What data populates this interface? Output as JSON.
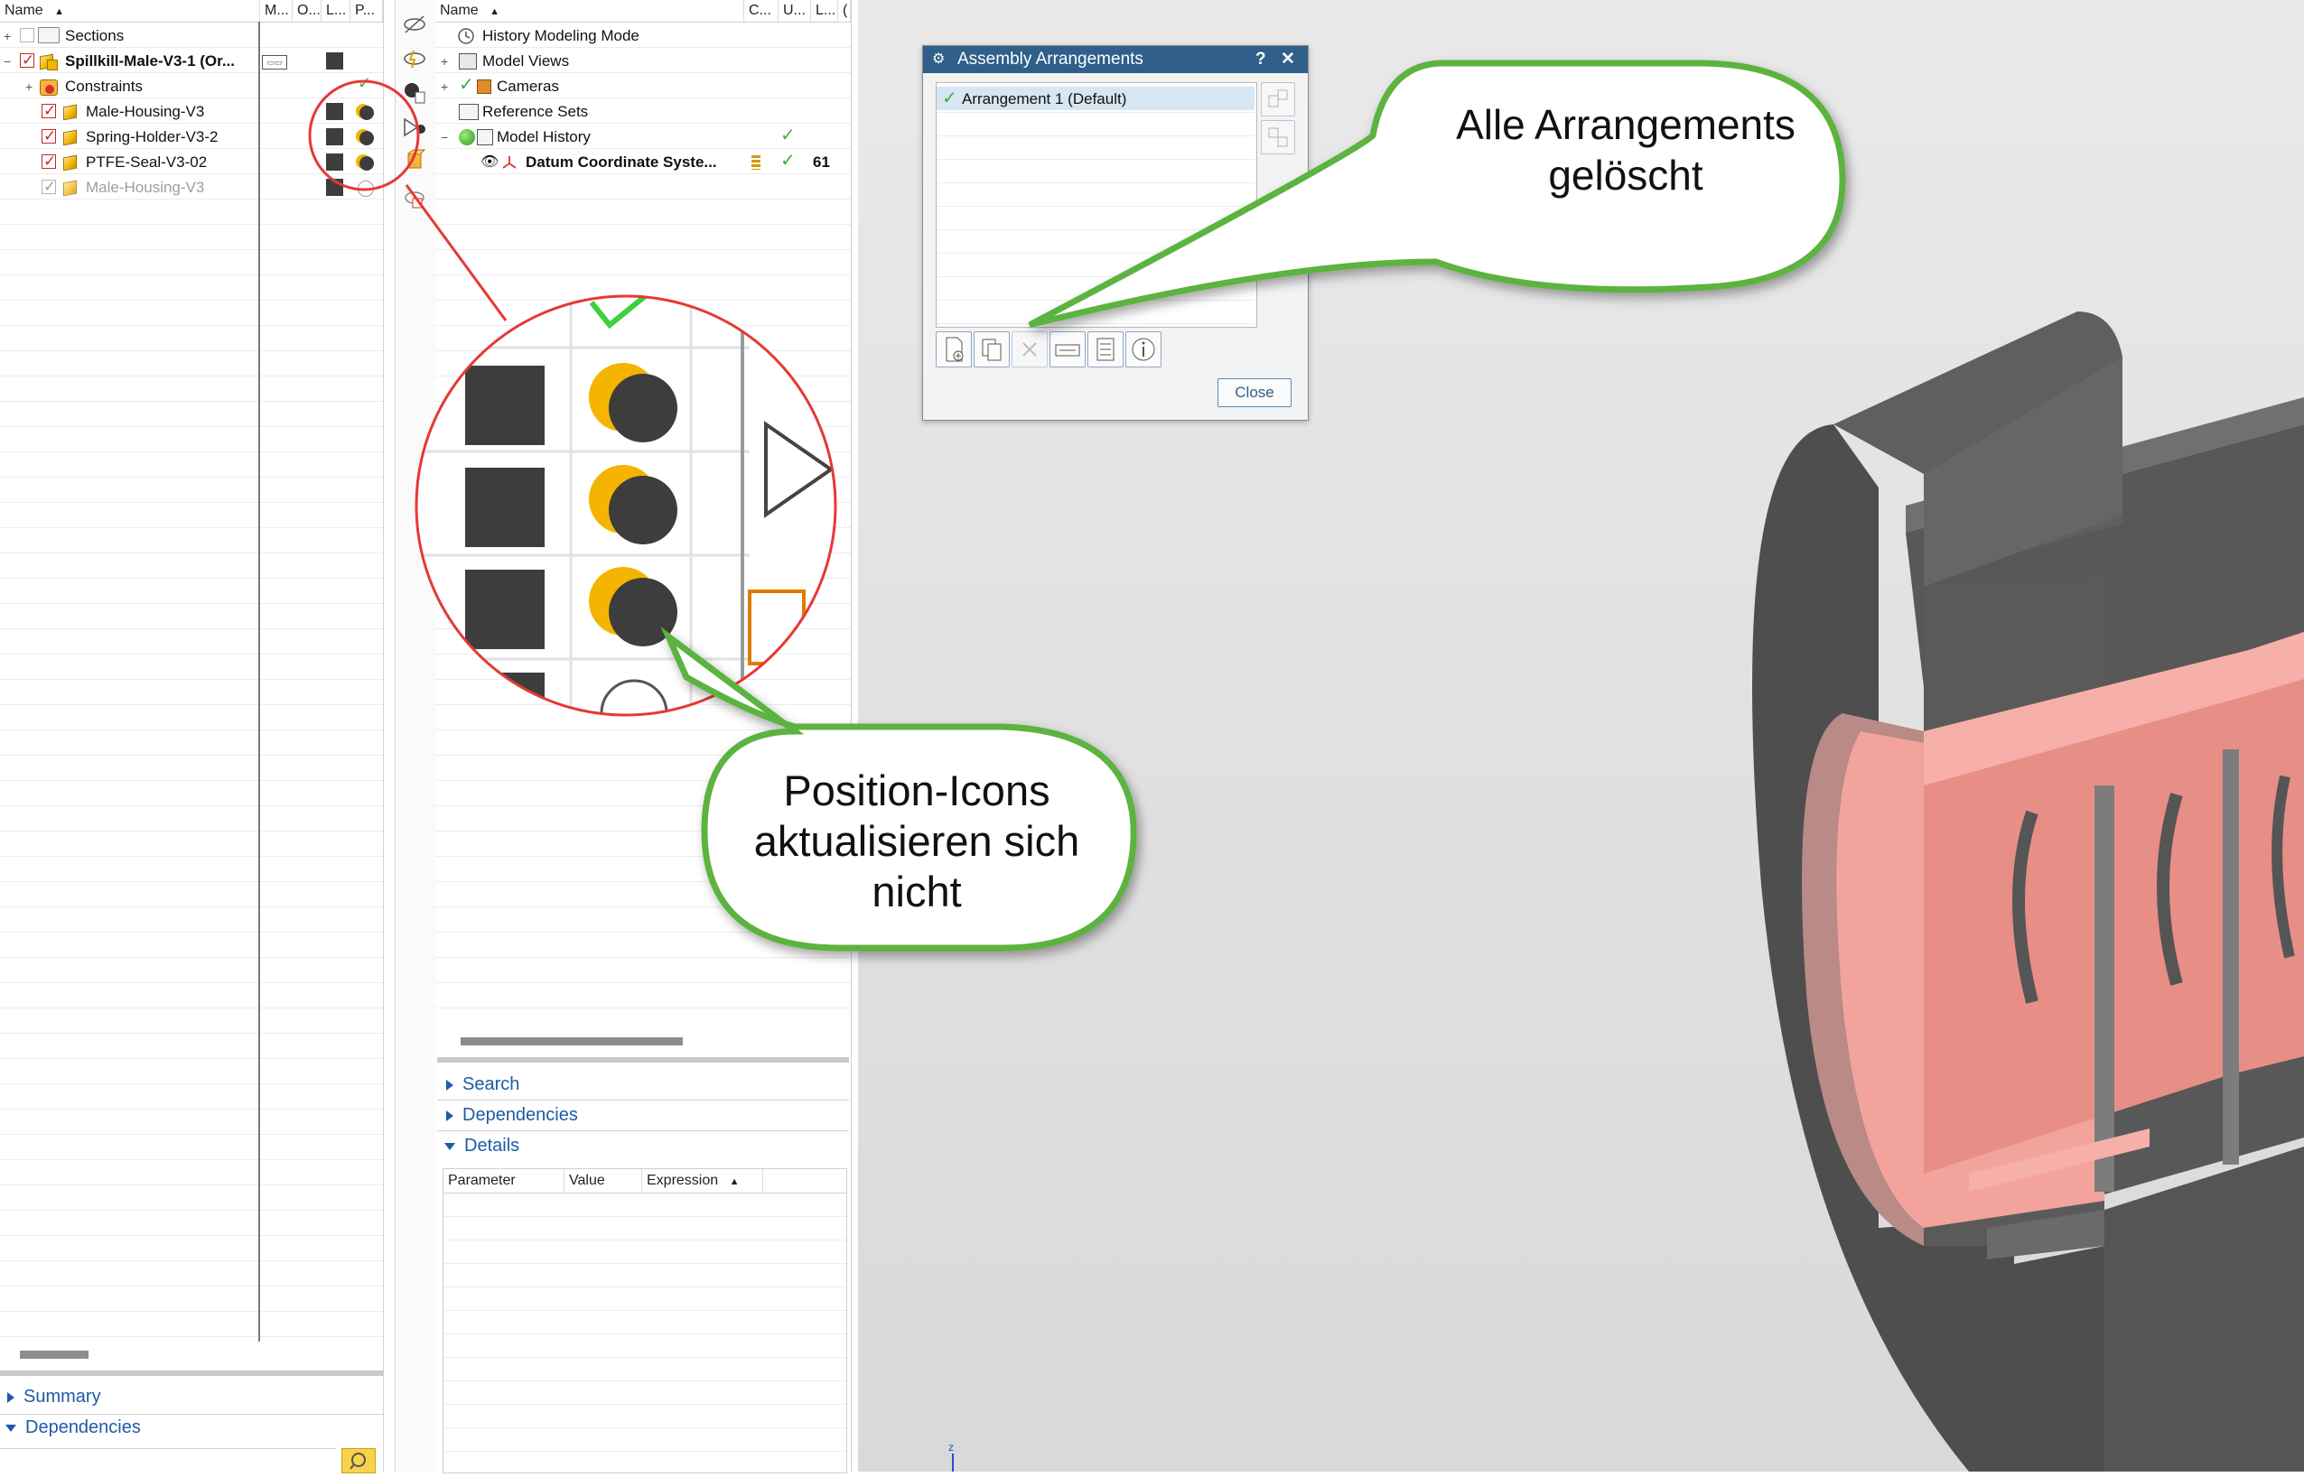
{
  "assembly_navigator": {
    "columns": [
      "Name",
      "M...",
      "O...",
      "L...",
      "P..."
    ],
    "rows": [
      {
        "label": "Sections",
        "kind": "folder"
      },
      {
        "label": "Spillkill-Male-V3-1 (Or...",
        "kind": "root"
      },
      {
        "label": "Constraints",
        "kind": "constraints"
      },
      {
        "label": "Male-Housing-V3",
        "kind": "part"
      },
      {
        "label": "Spring-Holder-V3-2",
        "kind": "part"
      },
      {
        "label": "PTFE-Seal-V3-02",
        "kind": "part"
      },
      {
        "label": "Male-Housing-V3",
        "kind": "part-suppressed"
      }
    ],
    "panels": {
      "summary": "Summary",
      "dependencies": "Dependencies"
    }
  },
  "part_navigator": {
    "columns": [
      "Name",
      "C...",
      "U...",
      "L...",
      "("
    ],
    "rows": [
      {
        "label": "History Modeling Mode"
      },
      {
        "label": "Model Views"
      },
      {
        "label": "Cameras"
      },
      {
        "label": "Reference Sets"
      },
      {
        "label": "Model History"
      },
      {
        "label": "Datum Coordinate Syste...",
        "value": "61"
      }
    ],
    "panels": {
      "search": "Search",
      "dependencies": "Dependencies",
      "details": "Details"
    },
    "details_columns": [
      "Parameter",
      "Value",
      "Expression"
    ]
  },
  "dialog": {
    "title": "Assembly Arrangements",
    "help": "?",
    "close_x": "✕",
    "arrangements": [
      "Arrangement 1 (Default)"
    ],
    "close_button": "Close"
  },
  "callouts": {
    "top": "Alle Arrangements gelöscht",
    "bottom": "Position-Icons aktualisieren sich nicht"
  },
  "triad_label": "z",
  "colors": {
    "accent_green": "#5cb33f",
    "dialog_title": "#2f5f8a",
    "part_salmon": "#f4a49c",
    "part_grey": "#5b5b5b",
    "magnifier_red": "#e53935"
  }
}
